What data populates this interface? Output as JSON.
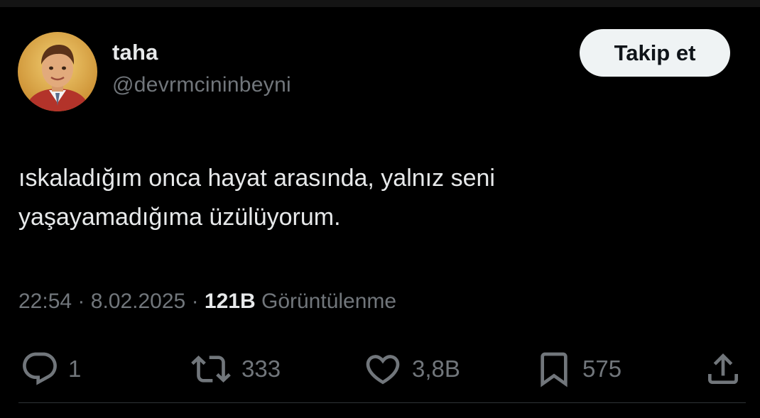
{
  "tweet": {
    "author": {
      "display_name": "taha",
      "handle": "@devrmcininbeyni",
      "avatar": "avatar-photo"
    },
    "follow_label": "Takip et",
    "text_lines": [
      "ıskaladığım onca hayat arasında, yalnız seni",
      "yaşayamadığıma üzülüyorum."
    ],
    "meta": {
      "time": "22:54",
      "separator": "·",
      "date": "8.02.2025",
      "views_count": "121B",
      "views_label": "Görüntülenme"
    },
    "actions": {
      "reply": {
        "icon": "reply-icon",
        "count": "1"
      },
      "retweet": {
        "icon": "retweet-icon",
        "count": "333"
      },
      "like": {
        "icon": "heart-icon",
        "count": "3,8B"
      },
      "bookmark": {
        "icon": "bookmark-icon",
        "count": "575"
      },
      "share": {
        "icon": "share-icon"
      }
    }
  },
  "colors": {
    "background": "#000000",
    "primary_text": "#e7e9ea",
    "secondary_text": "#71767b",
    "follow_button_bg": "#eff3f4",
    "follow_button_text": "#0f1419",
    "divider": "#2f3336"
  }
}
